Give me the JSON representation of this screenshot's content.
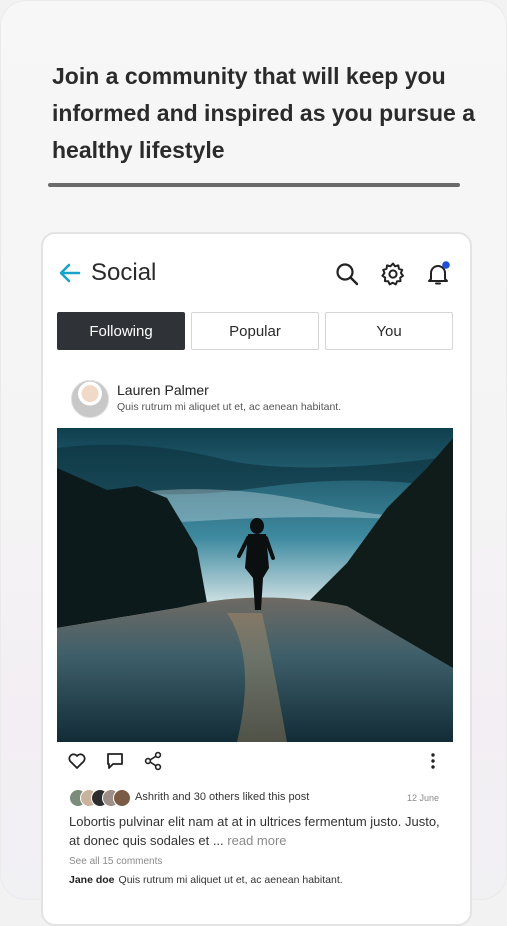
{
  "headline": "Join a community that will keep you informed and inspired as you pursue a healthy lifestyle",
  "app": {
    "title": "Social",
    "accent": "#1aa3c8",
    "tabs": [
      {
        "label": "Following",
        "active": true
      },
      {
        "label": "Popular",
        "active": false
      },
      {
        "label": "You",
        "active": false
      }
    ],
    "icons": [
      "back-arrow-icon",
      "search-icon",
      "gear-icon",
      "bell-icon"
    ]
  },
  "post": {
    "author": "Lauren Palmer",
    "subtitle": "Quis rutrum mi aliquet ut et, ac aenean habitant.",
    "likes_text": "Ashrith and 30 others liked this post",
    "date": "12 June",
    "caption": "Lobortis pulvinar elit nam at at in ultrices fermentum justo. Justo, at donec quis sodales et ...",
    "read_more": "read more",
    "see_comments": "See all 15 comments",
    "comment_author": "Jane doe",
    "comment_text": "Quis rutrum mi aliquet ut et, ac aenean habitant."
  }
}
